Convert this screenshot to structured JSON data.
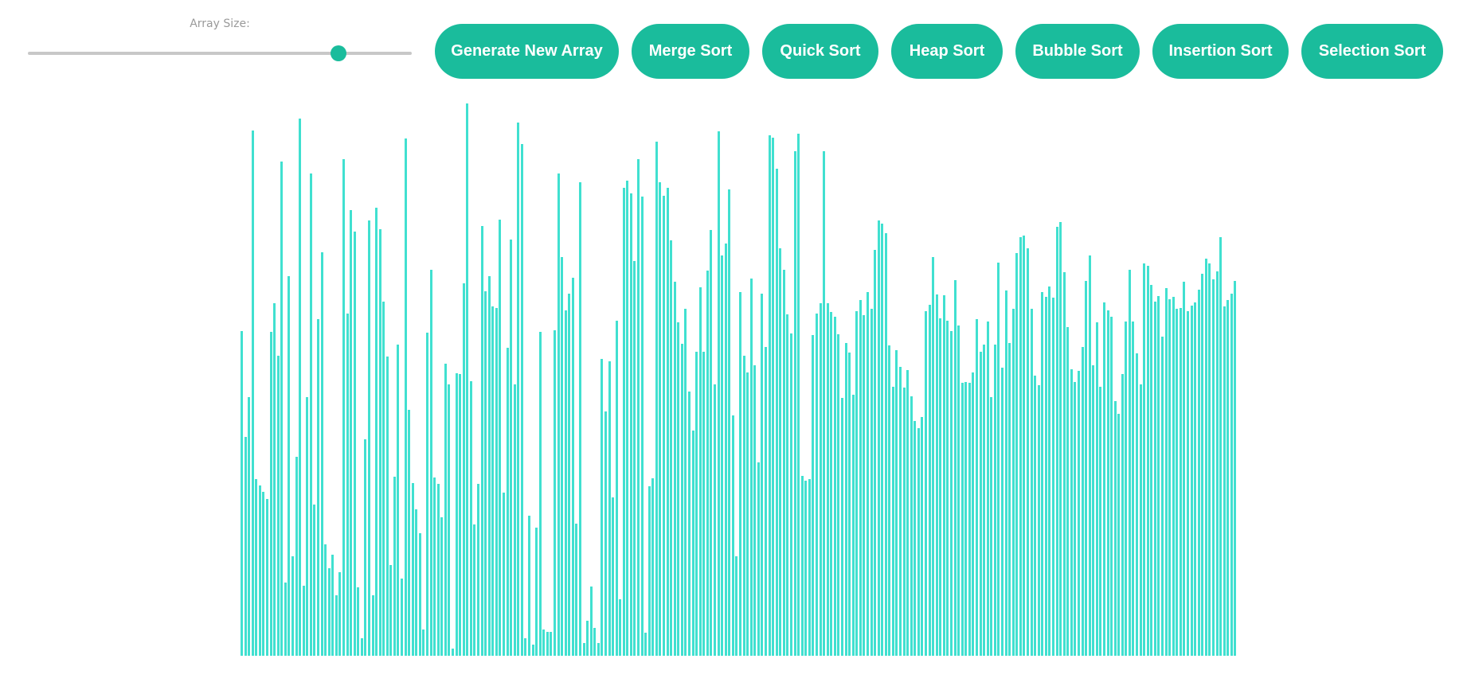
{
  "controls": {
    "array_size_label": "Array Size:",
    "array_size_fraction": 0.81,
    "buttons": {
      "generate": "Generate New Array",
      "merge": "Merge Sort",
      "quick": "Quick Sort",
      "heap": "Heap Sort",
      "bubble": "Bubble Sort",
      "insertion": "Insertion Sort",
      "selection": "Selection Sort"
    }
  },
  "colors": {
    "accent": "#1abc9c",
    "bar": "#40e0d0",
    "track": "#c8c8c8"
  },
  "array": {
    "max_value": 690,
    "values": [
      406,
      273,
      323,
      656,
      221,
      213,
      205,
      196,
      405,
      440,
      375,
      617,
      92,
      474,
      124,
      249,
      671,
      88,
      323,
      603,
      189,
      421,
      504,
      139,
      109,
      126,
      76,
      104,
      620,
      428,
      557,
      530,
      86,
      22,
      270,
      544,
      76,
      560,
      533,
      442,
      374,
      113,
      224,
      389,
      96,
      646,
      307,
      216,
      183,
      153,
      33,
      404,
      482,
      223,
      215,
      173,
      365,
      339,
      9,
      353,
      352,
      465,
      704,
      343,
      164,
      215,
      537,
      455,
      474,
      437,
      435,
      545,
      204,
      385,
      520,
      339,
      666,
      639,
      22,
      175,
      14,
      160,
      405,
      33,
      30,
      30,
      407,
      603,
      498,
      432,
      452,
      472,
      165,
      592,
      16,
      44,
      87,
      35,
      16,
      371,
      305,
      368,
      198,
      419,
      71,
      585,
      594,
      578,
      493,
      620,
      574,
      29,
      212,
      222,
      642,
      592,
      575,
      585,
      519,
      467,
      417,
      390,
      434,
      330,
      281,
      380,
      460,
      380,
      481,
      532,
      339,
      655,
      500,
      515,
      583,
      300,
      124,
      454,
      375,
      354,
      471,
      363,
      242,
      452,
      386,
      650,
      647,
      609,
      509,
      482,
      427,
      403,
      630,
      652,
      225,
      219,
      221,
      401,
      428,
      440,
      630,
      440,
      430,
      424,
      402,
      322,
      391,
      379,
      326,
      431,
      444,
      426,
      454,
      434,
      507,
      544,
      540,
      528,
      388,
      336,
      382,
      361,
      335,
      357,
      324,
      293,
      284,
      298,
      431,
      439,
      498,
      451,
      422,
      450,
      419,
      406,
      469,
      413,
      341,
      342,
      341,
      354,
      421,
      380,
      389,
      418,
      323,
      389,
      491,
      360,
      456,
      391,
      434,
      503,
      523,
      525,
      509,
      434,
      350,
      338,
      454,
      448,
      461,
      447,
      536,
      542,
      479,
      411,
      358,
      342,
      356,
      386,
      468,
      500,
      363,
      417,
      336,
      441,
      432,
      424,
      318,
      302,
      352,
      418,
      482,
      418,
      378,
      339,
      490,
      487,
      463,
      442,
      449,
      399,
      459,
      445,
      448,
      434,
      435,
      467,
      431,
      438,
      441,
      457,
      477,
      496,
      490,
      470,
      480,
      523,
      437,
      444,
      452,
      468
    ]
  }
}
